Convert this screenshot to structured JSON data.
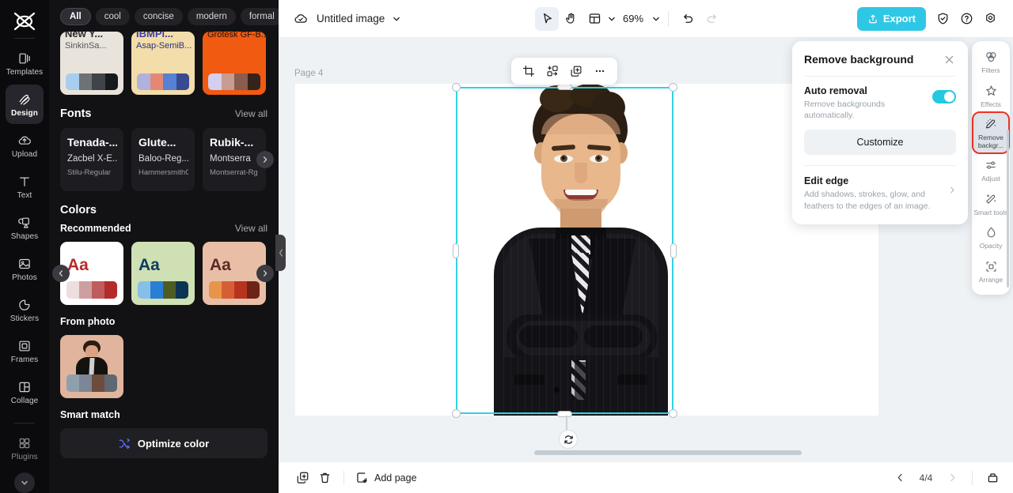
{
  "left_rail": {
    "logo_icon": "capcut-logo-icon",
    "items": [
      {
        "label": "Templates",
        "icon": "templates-icon",
        "active": false,
        "dim": false
      },
      {
        "label": "Design",
        "icon": "design-icon",
        "active": true,
        "dim": false
      },
      {
        "label": "Upload",
        "icon": "upload-cloud-icon",
        "active": false,
        "dim": false
      },
      {
        "label": "Text",
        "icon": "text-icon",
        "active": false,
        "dim": false
      },
      {
        "label": "Shapes",
        "icon": "shapes-icon",
        "active": false,
        "dim": false
      },
      {
        "label": "Photos",
        "icon": "photos-icon",
        "active": false,
        "dim": false
      },
      {
        "label": "Stickers",
        "icon": "stickers-icon",
        "active": false,
        "dim": false
      },
      {
        "label": "Frames",
        "icon": "frames-icon",
        "active": false,
        "dim": false
      },
      {
        "label": "Collage",
        "icon": "collage-icon",
        "active": false,
        "dim": false
      },
      {
        "label": "Plugins",
        "icon": "plugins-icon",
        "active": false,
        "dim": true
      }
    ],
    "collapse_icon": "chevron-down-icon"
  },
  "left_panel": {
    "tags": [
      {
        "label": "All",
        "active": true
      },
      {
        "label": "cool",
        "active": false
      },
      {
        "label": "concise",
        "active": false
      },
      {
        "label": "modern",
        "active": false
      },
      {
        "label": "formal",
        "active": false
      }
    ],
    "tag_more_icon": "chevron-down-icon",
    "template_cards": [
      {
        "line1": "New Y...",
        "line2": "SinkinSa...",
        "bg": "#e8e4dc",
        "line1_color": "#2a2a2a",
        "line2_color": "#55555a",
        "swatches": [
          "#a9cdee",
          "#6d7277",
          "#3f444b",
          "#17191c"
        ]
      },
      {
        "line1": "IBMPl...",
        "line2": "Asap-SemiB...",
        "bg": "#f3ddaa",
        "line1_color": "#3a3f9e",
        "line2_color": "#2b3480",
        "swatches": [
          "#b0b2dd",
          "#e58872",
          "#5681d4",
          "#3a4a91"
        ]
      },
      {
        "line1": "",
        "line2": "Grotesk GF-B...",
        "bg": "#f15a11",
        "line1_color": "#2b1a0c",
        "line2_color": "#231208",
        "swatches": [
          "#d3cfee",
          "#c79c92",
          "#8a5c4c",
          "#35231c"
        ]
      }
    ],
    "fonts_section": {
      "title": "Fonts",
      "view_all": "View all",
      "cards": [
        {
          "l1": "Tenada-...",
          "l2": "Zacbel X-E...",
          "l3": "Stilu-Regular"
        },
        {
          "l1": "Glute...",
          "l2": "Baloo-Reg...",
          "l3": "HammersmithOn..."
        },
        {
          "l1": "Rubik-...",
          "l2": "Montserra",
          "l3": "Montserrat-Rg"
        }
      ],
      "next_icon": "chevron-right-icon"
    },
    "colors_section": {
      "title": "Colors",
      "recommended_label": "Recommended",
      "view_all": "View all",
      "prev_icon": "chevron-left-icon",
      "next_icon": "chevron-right-icon",
      "cards": [
        {
          "bg": "#ffffff",
          "aa": "Aa",
          "aa_color": "#b42b2b",
          "palette": [
            "#eedede",
            "#ce9f9f",
            "#c05c5c",
            "#b32b2b"
          ]
        },
        {
          "bg": "#cfe0b4",
          "aa": "Aa",
          "aa_color": "#0e3b5e",
          "palette": [
            "#86bfe8",
            "#2a7fd4",
            "#4d5c23",
            "#0d3450"
          ]
        },
        {
          "bg": "#e8bfa6",
          "aa": "Aa",
          "aa_color": "#5a2a23",
          "palette": [
            "#e8954a",
            "#d55f33",
            "#b8331f",
            "#6e2318"
          ]
        }
      ]
    },
    "from_photo": {
      "title": "From photo",
      "palette": [
        "#8fa0ac",
        "#7c8697",
        "#6d4c3d",
        "#5e6772"
      ]
    },
    "smart_match": {
      "title": "Smart match",
      "button_label": "Optimize color",
      "button_icon": "shuffle-icon"
    },
    "collapse_icon": "chevron-left-icon"
  },
  "topbar": {
    "cloud_icon": "cloud-saved-icon",
    "doc_title": "Untitled image",
    "title_caret_icon": "chevron-down-icon",
    "tools": [
      {
        "name": "select-tool",
        "icon": "cursor-icon",
        "selected": true
      },
      {
        "name": "hand-tool",
        "icon": "hand-icon",
        "selected": false
      },
      {
        "name": "layout-tool",
        "icon": "layout-icon",
        "selected": false
      }
    ],
    "layout_caret_icon": "chevron-down-icon",
    "zoom_value": "69%",
    "zoom_caret_icon": "chevron-down-icon",
    "undo_icon": "undo-icon",
    "redo_icon": "redo-icon",
    "export_label": "Export",
    "export_icon": "export-upload-icon",
    "export_color": "#2ec8e6",
    "shield_icon": "shield-check-icon",
    "help_icon": "question-circle-icon",
    "settings_icon": "gear-icon"
  },
  "canvas": {
    "page_label": "Page 4",
    "object_toolbar": [
      {
        "name": "crop-button",
        "icon": "crop-icon"
      },
      {
        "name": "replace-button",
        "icon": "replace-icon"
      },
      {
        "name": "duplicate-button",
        "icon": "duplicate-icon"
      },
      {
        "name": "more-button",
        "icon": "ellipsis-icon"
      }
    ],
    "selection_color": "#32d2e8",
    "rotate_icon": "rotate-icon",
    "photo_alt": "portrait of smiling man in black pinstripe suit with patterned tie, arms crossed"
  },
  "right_rail": {
    "items": [
      {
        "label": "Filters",
        "icon": "filters-icon",
        "active": false
      },
      {
        "label": "Effects",
        "icon": "effects-icon",
        "active": false
      },
      {
        "label": "Remove backgr...",
        "icon": "remove-background-icon",
        "active": true
      },
      {
        "label": "Adjust",
        "icon": "adjust-sliders-icon",
        "active": false
      },
      {
        "label": "Smart tools",
        "icon": "smart-tools-icon",
        "active": false
      },
      {
        "label": "Opacity",
        "icon": "opacity-drop-icon",
        "active": false
      },
      {
        "label": "Arrange",
        "icon": "arrange-icon",
        "active": false
      }
    ],
    "highlight_color": "#ef3124"
  },
  "remove_background_panel": {
    "title": "Remove background",
    "close_icon": "close-icon",
    "auto_removal": {
      "title": "Auto removal",
      "description": "Remove backgrounds automatically.",
      "toggle_on": true,
      "toggle_color": "#24c8e0"
    },
    "customize_label": "Customize",
    "edit_edge": {
      "title": "Edit edge",
      "description": "Add shadows, strokes, glow, and feathers to the edges of an image.",
      "chevron_icon": "chevron-right-icon"
    }
  },
  "bottombar": {
    "duplicate_page_icon": "duplicate-page-icon",
    "delete_page_icon": "trash-icon",
    "add_page_label": "Add page",
    "add_page_icon": "add-page-icon",
    "prev_icon": "chevron-left-icon",
    "next_icon": "chevron-right-icon",
    "page_count": "4/4",
    "pages_panel_icon": "pages-panel-icon"
  }
}
